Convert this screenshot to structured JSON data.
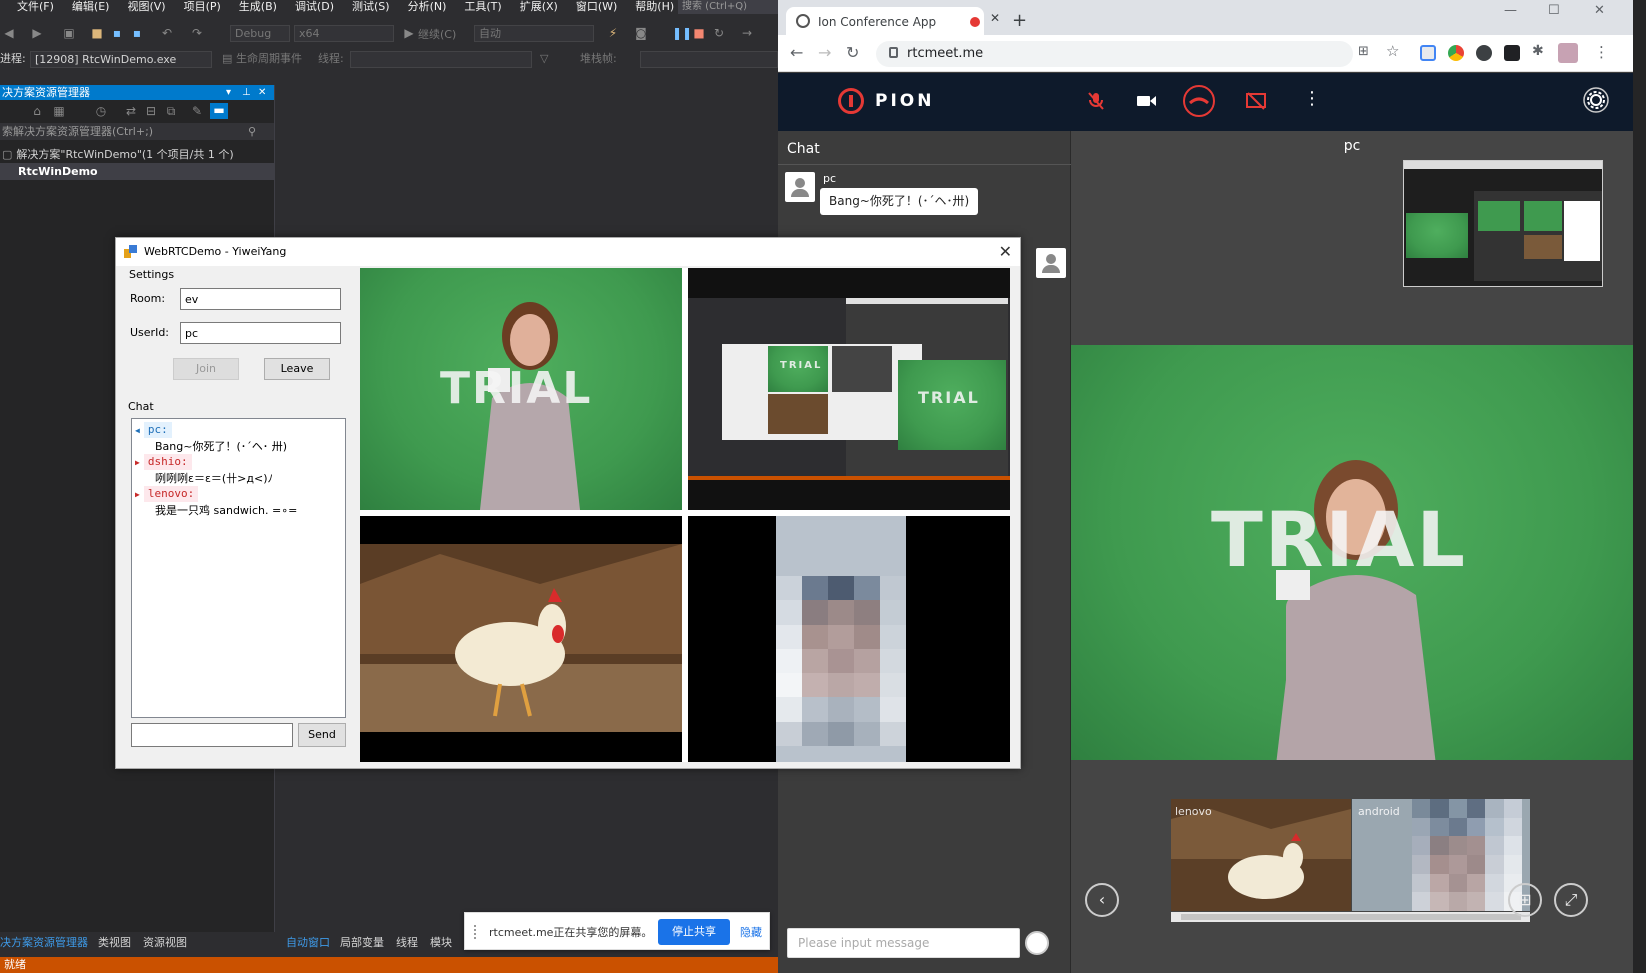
{
  "vs": {
    "menu": [
      "文件(F)",
      "编辑(E)",
      "视图(V)",
      "项目(P)",
      "生成(B)",
      "调试(D)",
      "测试(S)",
      "分析(N)",
      "工具(T)",
      "扩展(X)",
      "窗口(W)",
      "帮助(H)"
    ],
    "search_placeholder": "搜索 (Ctrl+Q)",
    "config": "Debug",
    "platform": "x64",
    "continue_label": "继续(C)",
    "auto_label": "自动",
    "process_label": "进程:",
    "process_value": "[12908] RtcWinDemo.exe",
    "lifecycle_label": "生命周期事件",
    "thread_label": "线程:",
    "stackframe_label": "堆栈帧:",
    "solution_panel_title": "决方案资源管理器",
    "solution_search": "索解决方案资源管理器(Ctrl+;)",
    "solution_root": "解决方案\"RtcWinDemo\"(1 个项目/共 1 个)",
    "project_name": "RtcWinDemo",
    "bottom_tabs_left": [
      "决方案资源管理器",
      "类视图",
      "资源视图"
    ],
    "bottom_tabs_right": [
      "自动窗口",
      "局部变量",
      "线程",
      "模块"
    ],
    "status": "就绪"
  },
  "share_bar": {
    "text": "rtcmeet.me正在共享您的屏幕。",
    "stop_label": "停止共享",
    "hide_label": "隐藏"
  },
  "demo": {
    "title": "WebRTCDemo - YiweiYang",
    "settings_label": "Settings",
    "room_label": "Room:",
    "room_value": "ev",
    "userid_label": "UserId:",
    "userid_value": "pc",
    "join_label": "Join",
    "leave_label": "Leave",
    "chat_label": "Chat",
    "chat": [
      {
        "name": "pc:",
        "message": "Bang~你死了！(･´ヘ･ 卅)"
      },
      {
        "name": "dshio:",
        "message": "咧咧咧ε＝ε＝(卄>д<)ﾉ"
      },
      {
        "name": "lenovo:",
        "message": "我是一只鸡 sandwich. =∘="
      }
    ],
    "send_label": "Send",
    "trial_text": "TRIAL"
  },
  "browser": {
    "tab_title": "Ion Conference App",
    "url": "rtcmeet.me",
    "brand": "PION",
    "chat_title": "Chat",
    "message_from": "pc",
    "message_text": "Bang~你死了！(･´ヘ･卅)",
    "input_placeholder": "Please input message",
    "main_speaker": "pc",
    "thumb_labels": [
      "lenovo",
      "android"
    ],
    "trial_text": "TRIAL",
    "colors": {
      "header": "#0e1a2b",
      "accent": "#e53935"
    }
  }
}
